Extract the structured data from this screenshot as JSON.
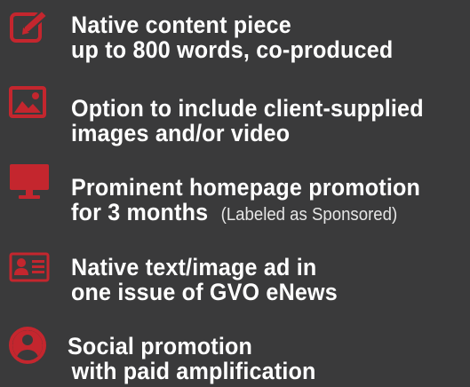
{
  "colors": {
    "background": "#3a3a3b",
    "icon_red": "#c4262e",
    "text": "#ffffff"
  },
  "features": [
    {
      "icon": "pencil-edit-icon",
      "line1": "Native content piece",
      "line2": "up to 800 words, co-produced"
    },
    {
      "icon": "image-icon",
      "line1": "Option to include client-supplied",
      "line2": "images and/or video"
    },
    {
      "icon": "monitor-icon",
      "line1": "Prominent homepage promotion",
      "line2": "for 3 months",
      "note": "(Labeled as Sponsored)"
    },
    {
      "icon": "id-card-icon",
      "line1": "Native text/image ad in",
      "line2": "one issue of GVO eNews"
    },
    {
      "icon": "user-circle-icon",
      "line1": "Social promotion",
      "line2": "with paid amplification"
    }
  ]
}
